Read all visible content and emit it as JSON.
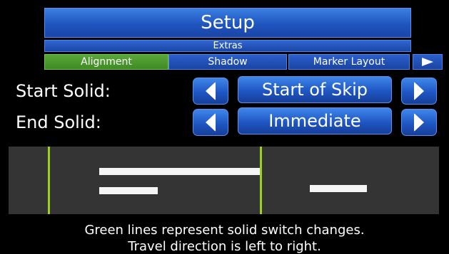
{
  "header": {
    "title": "Setup",
    "subtitle": "Extras"
  },
  "tabs": [
    {
      "label": "Alignment",
      "active": true
    },
    {
      "label": "Shadow",
      "active": false
    },
    {
      "label": "Marker Layout",
      "active": false
    }
  ],
  "tabs_next_icon": "arrow-right-icon",
  "settings": {
    "start_solid": {
      "label": "Start Solid:",
      "value": "Start of Skip"
    },
    "end_solid": {
      "label": "End Solid:",
      "value": "Immediate"
    }
  },
  "footer": {
    "line1": "Green lines represent solid switch changes.",
    "line2": "Travel direction is left to right."
  },
  "colors": {
    "accent_blue": "#1f56c3",
    "active_tab_green": "#4a9a2e",
    "switch_line_green": "#9ad21e",
    "preview_bg": "#343434"
  }
}
